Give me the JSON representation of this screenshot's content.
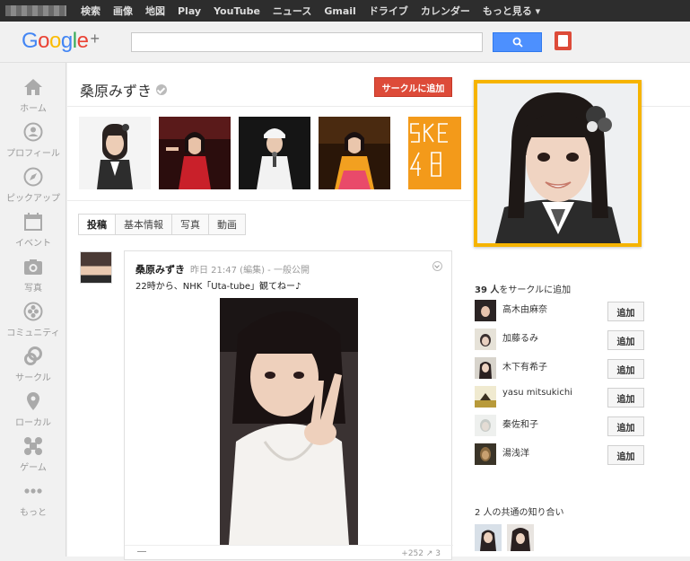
{
  "topbar": {
    "links": [
      "検索",
      "画像",
      "地図",
      "Play",
      "YouTube",
      "ニュース",
      "Gmail",
      "ドライブ",
      "カレンダー",
      "もっと見る ▾"
    ]
  },
  "header": {
    "logo": {
      "text": "Google",
      "plus": "+"
    },
    "search_placeholder": "",
    "colors": {
      "search_button": "#4d90fe",
      "notification": "#dd4b39"
    }
  },
  "leftnav": {
    "items": [
      {
        "label": "ホーム",
        "icon": "home-icon"
      },
      {
        "label": "プロフィール",
        "icon": "profile-icon"
      },
      {
        "label": "ピックアップ",
        "icon": "compass-icon"
      },
      {
        "label": "イベント",
        "icon": "calendar-icon"
      },
      {
        "label": "写真",
        "icon": "camera-icon"
      },
      {
        "label": "コミュニティ",
        "icon": "communities-icon"
      },
      {
        "label": "サークル",
        "icon": "circles-icon"
      },
      {
        "label": "ローカル",
        "icon": "pin-icon"
      },
      {
        "label": "ゲーム",
        "icon": "games-icon"
      },
      {
        "label": "もっと",
        "icon": "more-icon"
      }
    ]
  },
  "profile": {
    "name": "桑原みずき",
    "add_to_circles": "サークルに追加",
    "accent_color": "#dd4b39",
    "photo_frame_color": "#f6b400"
  },
  "tabs": [
    "投稿",
    "基本情報",
    "写真",
    "動画"
  ],
  "post": {
    "author": "桑原みずき",
    "meta": "昨日 21:47 (編集) - 一般公開",
    "text": "22時から、NHK「Uta-tube」観てねー♪",
    "footer_count": "+252  ↗ 3"
  },
  "sidebar": {
    "circled_count": "39 人",
    "circled_suffix": "をサークルに追加",
    "add_label": "追加",
    "followers": [
      {
        "name": "高木由麻奈"
      },
      {
        "name": "加藤るみ"
      },
      {
        "name": "木下有希子"
      },
      {
        "name": "yasu mitsukichi"
      },
      {
        "name": "秦佐和子"
      },
      {
        "name": "湯浅洋"
      }
    ],
    "mutual_title": "2 人の共通の知り合い"
  }
}
